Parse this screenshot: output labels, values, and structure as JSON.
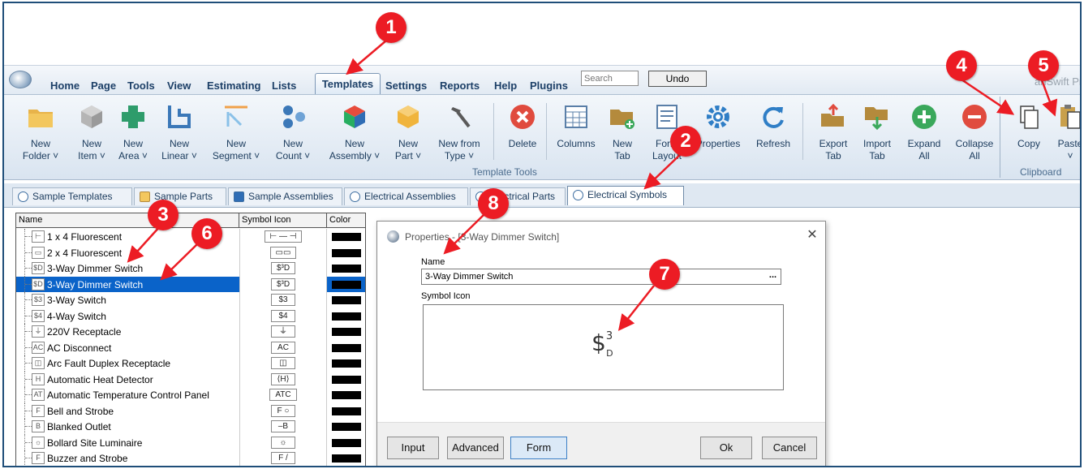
{
  "menu": {
    "items": [
      "Home",
      "Page",
      "Tools",
      "View",
      "Estimating",
      "Lists"
    ],
    "active": "Templates",
    "items_right": [
      "Settings",
      "Reports",
      "Help",
      "Plugins"
    ],
    "search_placeholder": "Search",
    "undo_label": "Undo",
    "brand": "anSwift Pro"
  },
  "ribbon": {
    "buttons": [
      {
        "label": "New\nFolder ˅",
        "icon": "folder-icon"
      },
      {
        "label": "New\nItem ˅",
        "icon": "cube-icon"
      },
      {
        "label": "New\nArea ˅",
        "icon": "area-shape-icon"
      },
      {
        "label": "New\nLinear ˅",
        "icon": "linear-shape-icon"
      },
      {
        "label": "New\nSegment ˅",
        "icon": "segment-icon"
      },
      {
        "label": "New\nCount ˅",
        "icon": "count-dots-icon"
      },
      {
        "label": "New\nAssembly ˅",
        "icon": "assembly-cube-icon"
      },
      {
        "label": "New\nPart ˅",
        "icon": "part-cube-icon"
      },
      {
        "label": "New from\nType ˅",
        "icon": "hammer-icon"
      },
      {
        "label": "Delete",
        "icon": "delete-icon"
      },
      {
        "label": "Columns",
        "icon": "columns-icon"
      },
      {
        "label": "New\nTab",
        "icon": "new-tab-icon"
      },
      {
        "label": "Form\nLayout",
        "icon": "form-layout-icon"
      },
      {
        "label": "Properties",
        "icon": "gear-icon"
      },
      {
        "label": "Refresh",
        "icon": "refresh-icon"
      },
      {
        "label": "Export\nTab",
        "icon": "export-tab-icon"
      },
      {
        "label": "Import\nTab",
        "icon": "import-tab-icon"
      },
      {
        "label": "Expand\nAll",
        "icon": "expand-icon"
      },
      {
        "label": "Collapse\nAll",
        "icon": "collapse-icon"
      },
      {
        "label": "Copy",
        "icon": "copy-icon"
      },
      {
        "label": "Paste\n˅",
        "icon": "paste-icon"
      }
    ],
    "group_template_tools": "Template Tools",
    "group_clipboard": "Clipboard"
  },
  "tabs": [
    {
      "label": "Sample Templates"
    },
    {
      "label": "Sample Parts"
    },
    {
      "label": "Sample Assemblies"
    },
    {
      "label": "Electrical Assemblies"
    },
    {
      "label": "Electrical Parts"
    },
    {
      "label": "Electrical Symbols"
    }
  ],
  "grid": {
    "headers": [
      "Name",
      "Symbol Icon",
      "Color"
    ],
    "rows": [
      {
        "name": "1 x 4 Fluorescent",
        "sym": "⊢—",
        "icon": "⊢ — ⊣"
      },
      {
        "name": "2 x 4 Fluorescent",
        "sym": "▭",
        "icon": "▭▭"
      },
      {
        "name": "3-Way Dimmer Switch",
        "sym": "$D",
        "icon": "$³D"
      },
      {
        "name": "3-Way Dimmer Switch",
        "sym": "$D",
        "icon": "$³D"
      },
      {
        "name": "3-Way Switch",
        "sym": "$3",
        "icon": "$3"
      },
      {
        "name": "4-Way Switch",
        "sym": "$4",
        "icon": "$4"
      },
      {
        "name": "220V Receptacle",
        "sym": "⏚",
        "icon": "⏚"
      },
      {
        "name": "AC Disconnect",
        "sym": "AC",
        "icon": "AC"
      },
      {
        "name": "Arc Fault Duplex Receptacle",
        "sym": "◫",
        "icon": "◫"
      },
      {
        "name": "Automatic Heat Detector",
        "sym": "H",
        "icon": "⟨H⟩"
      },
      {
        "name": "Automatic Temperature Control Panel",
        "sym": "AT",
        "icon": "ATC"
      },
      {
        "name": "Bell and Strobe",
        "sym": "F",
        "icon": "F ○"
      },
      {
        "name": "Blanked Outlet",
        "sym": "B",
        "icon": "–B"
      },
      {
        "name": "Bollard Site Luminaire",
        "sym": "☼",
        "icon": "☼"
      },
      {
        "name": "Buzzer and Strobe",
        "sym": "F",
        "icon": "F /"
      }
    ]
  },
  "dialog": {
    "title": "Properties - [3-Way Dimmer Switch]",
    "name_label": "Name",
    "name_value": "3-Way Dimmer Switch",
    "ellipsis": "...",
    "symbol_label": "Symbol Icon",
    "symbol_main": "$",
    "symbol_sup": "3",
    "symbol_sub": "D",
    "buttons": {
      "input": "Input",
      "advanced": "Advanced",
      "form": "Form",
      "ok": "Ok",
      "cancel": "Cancel"
    }
  },
  "callouts": [
    "1",
    "2",
    "3",
    "4",
    "5",
    "6",
    "7",
    "8"
  ],
  "colors": {
    "callout": "#ec1c24",
    "selection": "#0a63c9",
    "menu_text": "#1c3f67"
  }
}
